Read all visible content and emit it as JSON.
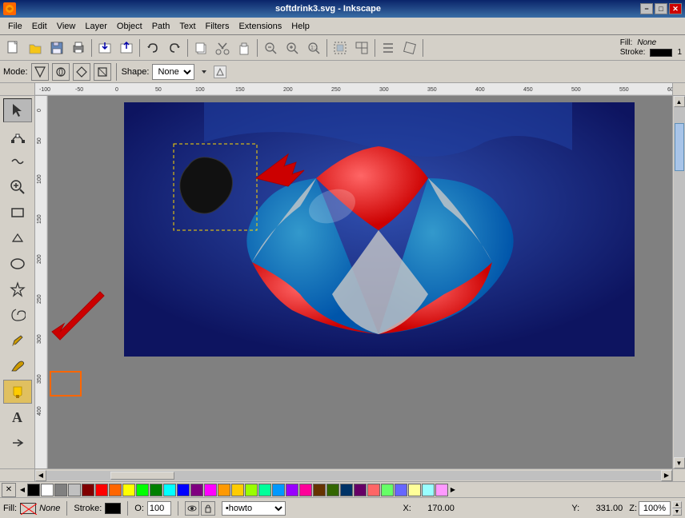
{
  "titlebar": {
    "title": "softdrink3.svg - Inkscape",
    "minimize": "−",
    "maximize": "□",
    "close": "✕"
  },
  "menubar": {
    "items": [
      "File",
      "Edit",
      "View",
      "Layer",
      "Object",
      "Path",
      "Text",
      "Filters",
      "Extensions",
      "Help"
    ]
  },
  "toolbar2": {
    "mode_label": "Mode:",
    "shape_label": "Shape:",
    "shape_value": "None"
  },
  "fill_stroke": {
    "fill_label": "Fill:",
    "fill_value": "None",
    "stroke_label": "Stroke:",
    "stroke_value": "1"
  },
  "statusbar": {
    "fill_label": "Fill:",
    "fill_value": "None",
    "stroke_label": "Stroke:",
    "opacity_label": "O:",
    "opacity_value": "100",
    "layer_value": "•howto",
    "x_label": "X:",
    "x_value": "170.00",
    "y_label": "Y:",
    "y_value": "331.00",
    "zoom_label": "Z:",
    "zoom_value": "100%"
  },
  "tools": [
    {
      "name": "selector",
      "icon": "↖",
      "label": "selector-tool"
    },
    {
      "name": "node",
      "icon": "⬡",
      "label": "node-tool"
    },
    {
      "name": "tweak",
      "icon": "〜",
      "label": "tweak-tool"
    },
    {
      "name": "zoom",
      "icon": "🔍",
      "label": "zoom-tool"
    },
    {
      "name": "rect",
      "icon": "▭",
      "label": "rect-tool"
    },
    {
      "name": "3d-box",
      "icon": "⬜",
      "label": "3dbox-tool"
    },
    {
      "name": "ellipse",
      "icon": "◯",
      "label": "ellipse-tool"
    },
    {
      "name": "star",
      "icon": "★",
      "label": "star-tool"
    },
    {
      "name": "spiral",
      "icon": "🌀",
      "label": "spiral-tool"
    },
    {
      "name": "pencil",
      "icon": "✏",
      "label": "pencil-tool"
    },
    {
      "name": "calligraphy",
      "icon": "✒",
      "label": "calligraphy-tool"
    },
    {
      "name": "paint-bucket",
      "icon": "🪣",
      "label": "paintbucket-tool"
    },
    {
      "name": "text",
      "icon": "A",
      "label": "text-tool"
    }
  ],
  "palette": {
    "colors": [
      "#000000",
      "#ffffff",
      "#808080",
      "#c0c0c0",
      "#800000",
      "#ff0000",
      "#ff6600",
      "#ffff00",
      "#00ff00",
      "#008000",
      "#00ffff",
      "#0000ff",
      "#800080",
      "#ff00ff",
      "#ff9900",
      "#ffcc00",
      "#99ff00",
      "#00ff99",
      "#0099ff",
      "#9900ff",
      "#ff0099",
      "#663300",
      "#336600",
      "#003366",
      "#660066",
      "#ff6666",
      "#66ff66",
      "#6666ff",
      "#ffff99",
      "#99ffff",
      "#ff99ff"
    ]
  }
}
